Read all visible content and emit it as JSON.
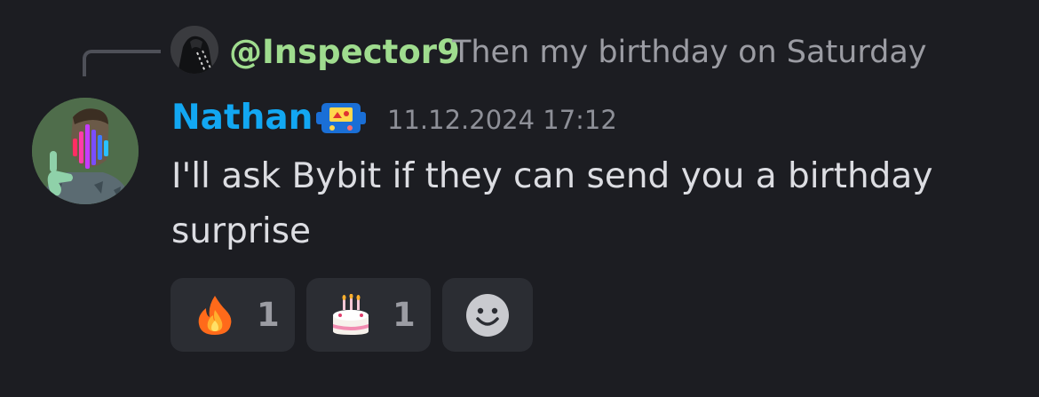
{
  "reply": {
    "username": "@Inspector9",
    "text": "Then my birthday on Saturday"
  },
  "message": {
    "author": "Nathan",
    "timestamp": "11.12.2024 17:12",
    "text": "I'll ask Bybit if they can send you a birthday surprise",
    "author_color": "#12a7f2"
  },
  "reactions": [
    {
      "emoji": "fire-emoji",
      "count": "1"
    },
    {
      "emoji": "birthday-cake-emoji",
      "count": "1"
    },
    {
      "emoji": "add-reaction-icon"
    }
  ],
  "colors": {
    "background": "#1c1d22",
    "reply_name": "#9fdc8e",
    "reaction_bg": "#2b2d33"
  }
}
